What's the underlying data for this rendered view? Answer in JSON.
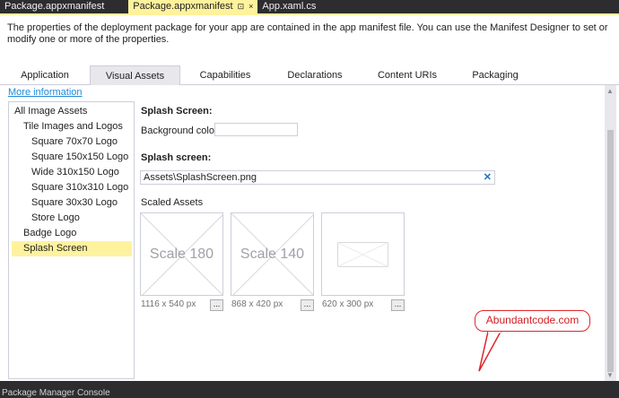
{
  "doc_tabs": [
    {
      "label": "Package.appxmanifest"
    },
    {
      "label": "Package.appxmanifest",
      "pin": "⊡",
      "close": "×"
    },
    {
      "label": "App.xaml.cs"
    }
  ],
  "description": "The properties of the deployment package for your app are contained in the app manifest file. You can use the Manifest Designer to set or modify one or more of the properties.",
  "designer_tabs": [
    "Application",
    "Visual Assets",
    "Capabilities",
    "Declarations",
    "Content URIs",
    "Packaging"
  ],
  "more_information": "More information",
  "nav": {
    "items": [
      "All Image Assets",
      "Tile Images and Logos",
      "Square 70x70 Logo",
      "Square 150x150 Logo",
      "Wide 310x150 Logo",
      "Square 310x310 Logo",
      "Square 30x30 Logo",
      "Store Logo",
      "Badge Logo",
      "Splash Screen"
    ],
    "selected": "Splash Screen"
  },
  "content": {
    "section_heading": "Splash Screen:",
    "bg_color_label": "Background color:",
    "bg_color_value": "",
    "splash_label": "Splash screen:",
    "splash_path": "Assets\\SplashScreen.png",
    "scaled_assets_label": "Scaled Assets",
    "tiles": [
      {
        "text": "Scale 180",
        "size": "1116 x 540 px",
        "browse": "..."
      },
      {
        "text": "Scale 140",
        "size": "868 x 420 px",
        "browse": "..."
      },
      {
        "text": "",
        "size": "620 x 300 px",
        "browse": "..."
      }
    ]
  },
  "callout": "Abundantcode.com",
  "bottom_panel": "Package Manager Console",
  "colors": {
    "accent_tab": "#fff29d",
    "link": "#1e8ad7",
    "callout_red": "#e0262a",
    "chrome_dark": "#2d2d30"
  }
}
